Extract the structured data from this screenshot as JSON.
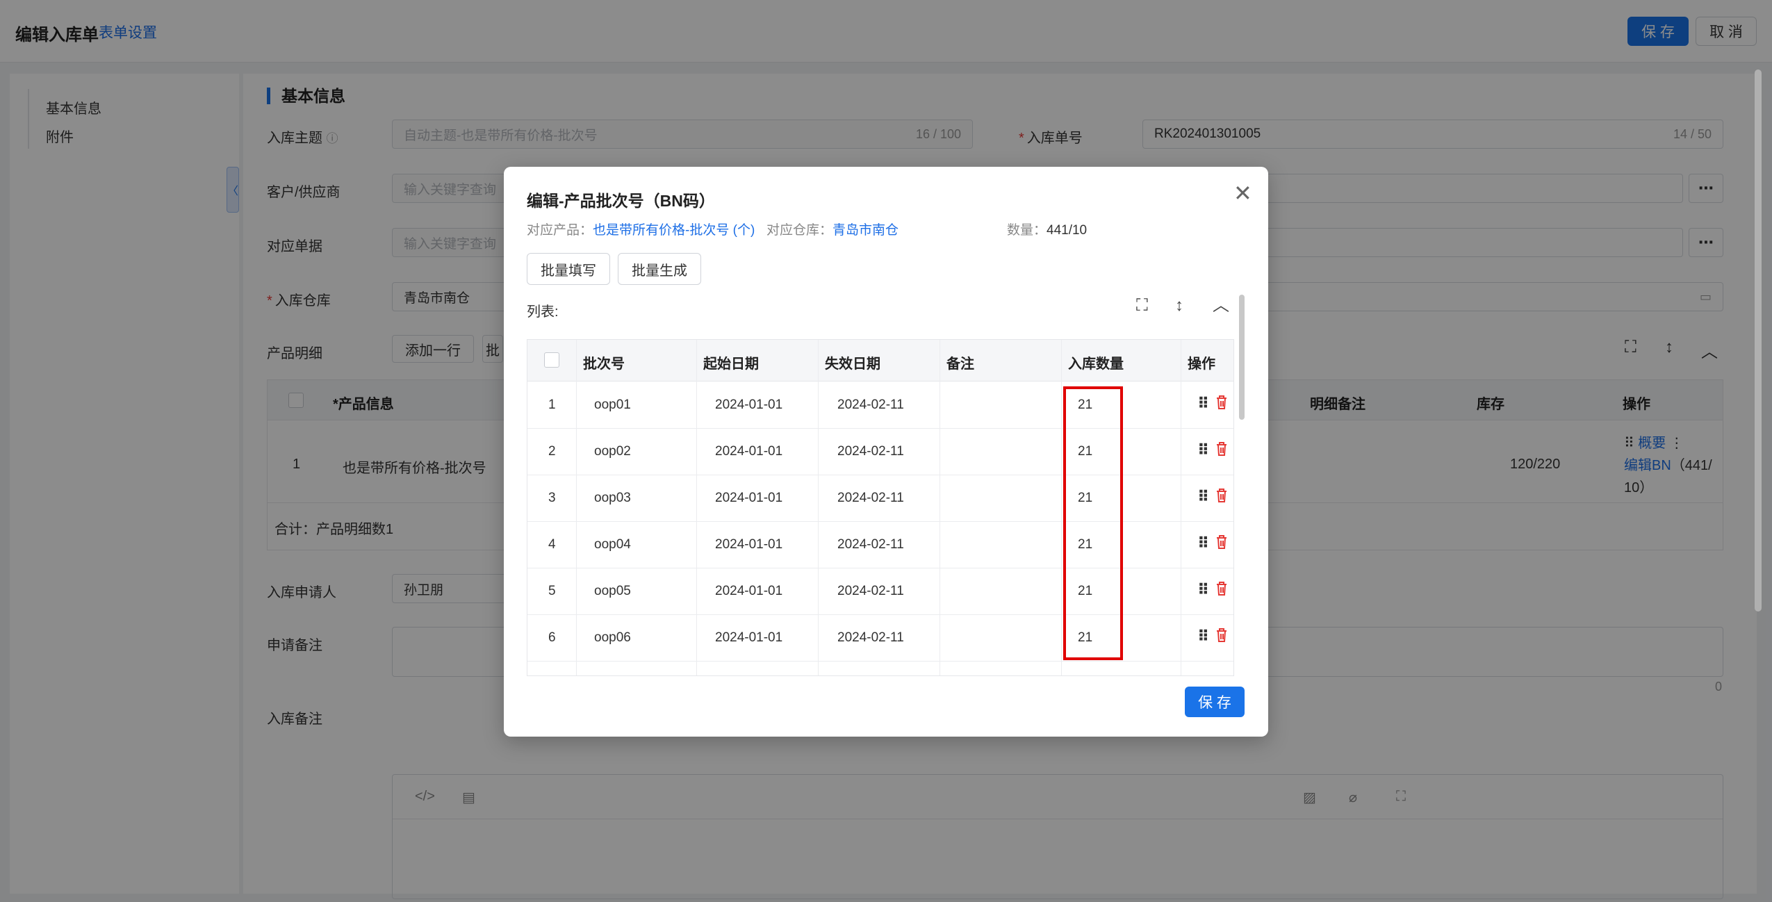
{
  "header": {
    "title": "编辑入库单",
    "form_settings": "表单设置",
    "save_label": "保 存",
    "cancel_label": "取 消"
  },
  "nav": {
    "items": [
      "基本信息",
      "附件"
    ]
  },
  "main": {
    "section_title": "基本信息",
    "subject": {
      "label": "入库主题",
      "placeholder": "自动主题-也是带所有价格-批次号",
      "count": "16 / 100"
    },
    "order_no": {
      "label": "入库单号",
      "value": "RK202401301005",
      "count": "14 / 50"
    },
    "customer": {
      "label": "客户/供应商",
      "placeholder": "输入关键字查询"
    },
    "ref_doc": {
      "label": "对应单据",
      "placeholder": "输入关键字查询"
    },
    "warehouse": {
      "label": "入库仓库",
      "value": "青岛市南仓"
    },
    "product_detail": {
      "label": "产品明细",
      "add_row": "添加一行",
      "second_btn": "批"
    },
    "product_table": {
      "headers": [
        "*产品信息",
        "明细备注",
        "库存",
        "操作"
      ],
      "row": {
        "index": "1",
        "product": "也是带所有价格-批次号",
        "stock": "120/220",
        "op_overview": "概要",
        "op_edit": "编辑BN",
        "op_count": "（441/",
        "op_count2": "10）"
      },
      "total": "合计：产品明细数1"
    },
    "applicant": {
      "label": "入库申请人",
      "value": "孙卫朋"
    },
    "apply_remark": {
      "label": "申请备注",
      "count": "0"
    },
    "in_remark": {
      "label": "入库备注"
    }
  },
  "dialog": {
    "title": "编辑-产品批次号（BN码）",
    "product_label": "对应产品：",
    "product_value": "也是带所有价格-批次号 (个)",
    "warehouse_label": "对应仓库：",
    "warehouse_value": "青岛市南仓",
    "qty_label": "数量：",
    "qty_value": "441/10",
    "batch_fill": "批量填写",
    "batch_generate": "批量生成",
    "list_label": "列表:",
    "headers": [
      "批次号",
      "起始日期",
      "失效日期",
      "备注",
      "入库数量",
      "操作"
    ],
    "rows": [
      {
        "no": "1",
        "batch": "oop01",
        "start": "2024-01-01",
        "end": "2024-02-11",
        "remark": "",
        "qty": "21"
      },
      {
        "no": "2",
        "batch": "oop02",
        "start": "2024-01-01",
        "end": "2024-02-11",
        "remark": "",
        "qty": "21"
      },
      {
        "no": "3",
        "batch": "oop03",
        "start": "2024-01-01",
        "end": "2024-02-11",
        "remark": "",
        "qty": "21"
      },
      {
        "no": "4",
        "batch": "oop04",
        "start": "2024-01-01",
        "end": "2024-02-11",
        "remark": "",
        "qty": "21"
      },
      {
        "no": "5",
        "batch": "oop05",
        "start": "2024-01-01",
        "end": "2024-02-11",
        "remark": "",
        "qty": "21"
      },
      {
        "no": "6",
        "batch": "oop06",
        "start": "2024-01-01",
        "end": "2024-02-11",
        "remark": "",
        "qty": "21"
      }
    ],
    "save_label": "保 存"
  },
  "colors": {
    "primary": "#1a73e8",
    "highlight": "#e00000",
    "danger": "#e53935"
  }
}
